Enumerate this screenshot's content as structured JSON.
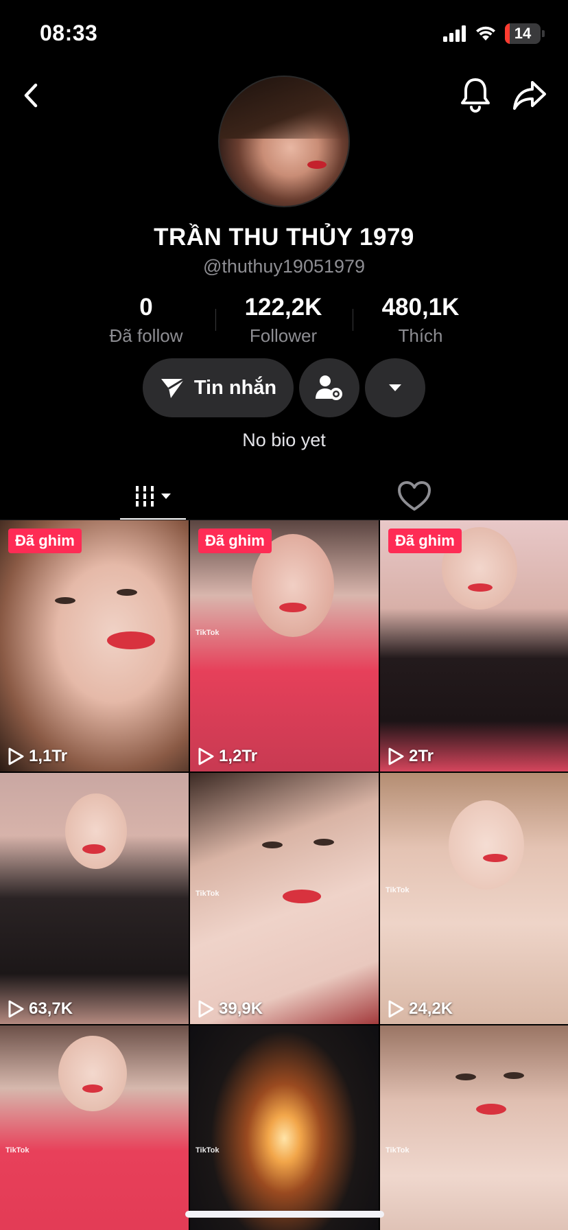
{
  "status_bar": {
    "time": "08:33",
    "battery": "14",
    "battery_level": 0.14,
    "battery_color": "#ff3b30"
  },
  "profile": {
    "display_name": "TRẦN THU THỦY 1979",
    "username": "@thuthuy19051979",
    "bio": "No bio yet"
  },
  "stats": [
    {
      "value": "0",
      "label": "Đã follow"
    },
    {
      "value": "122,2K",
      "label": "Follower"
    },
    {
      "value": "480,1K",
      "label": "Thích"
    }
  ],
  "actions": {
    "message_label": "Tin nhắn"
  },
  "tabs": {
    "videos_icon": "grid-icon",
    "liked_icon": "heart-icon"
  },
  "colors": {
    "accent": "#fe2c55",
    "background": "#000000",
    "button_bg": "#2c2c2e",
    "muted_text": "#8e8e93"
  },
  "videos": [
    {
      "pinned": "Đã ghim",
      "views": "1,1Tr"
    },
    {
      "pinned": "Đã ghim",
      "views": "1,2Tr",
      "watermark": "TikTok"
    },
    {
      "pinned": "Đã ghim",
      "views": "2Tr"
    },
    {
      "views": "63,7K"
    },
    {
      "views": "39,9K",
      "watermark": "TikTok"
    },
    {
      "views": "24,2K",
      "watermark": "TikTok"
    },
    {
      "watermark": "TikTok"
    },
    {
      "watermark": "TikTok"
    },
    {
      "watermark": "TikTok"
    }
  ]
}
